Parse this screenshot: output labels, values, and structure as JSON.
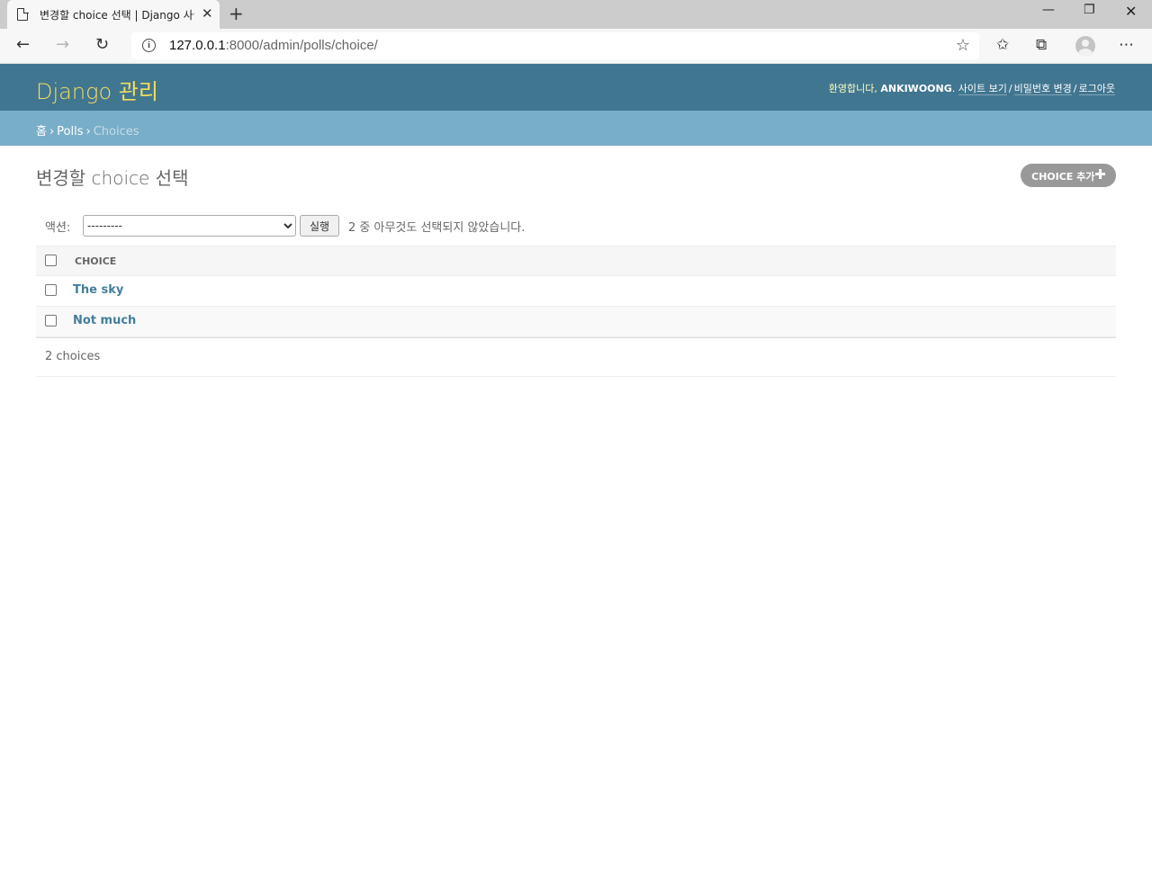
{
  "browser": {
    "tab_title": "변경할 choice 선택 | Django 사이트 관리",
    "url_host": "127.0.0.1",
    "url_rest": ":8000/admin/polls/choice/"
  },
  "header": {
    "branding": "Django 관리",
    "welcome": "환영합니다,",
    "username": "ANKIWOONG",
    "view_site": "사이트 보기",
    "change_password": "비밀번호 변경",
    "logout": "로그아웃"
  },
  "breadcrumbs": {
    "home": "홈",
    "app": "Polls",
    "current": "Choices"
  },
  "content": {
    "title": "변경할 choice 선택",
    "add_button": "CHOICE 추가"
  },
  "actions": {
    "label": "액션:",
    "selected_option": "---------",
    "go_button": "실행",
    "counter": "2 중 아무것도 선택되지 않았습니다."
  },
  "table": {
    "column_header": "CHOICE",
    "rows": [
      "The sky",
      "Not much"
    ]
  },
  "paginator": {
    "count_text": "2 choices"
  },
  "colors": {
    "header_bg": "#417690",
    "breadcrumbs_bg": "#79aec8",
    "branding": "#f5dd5d",
    "link": "#447e9b"
  }
}
